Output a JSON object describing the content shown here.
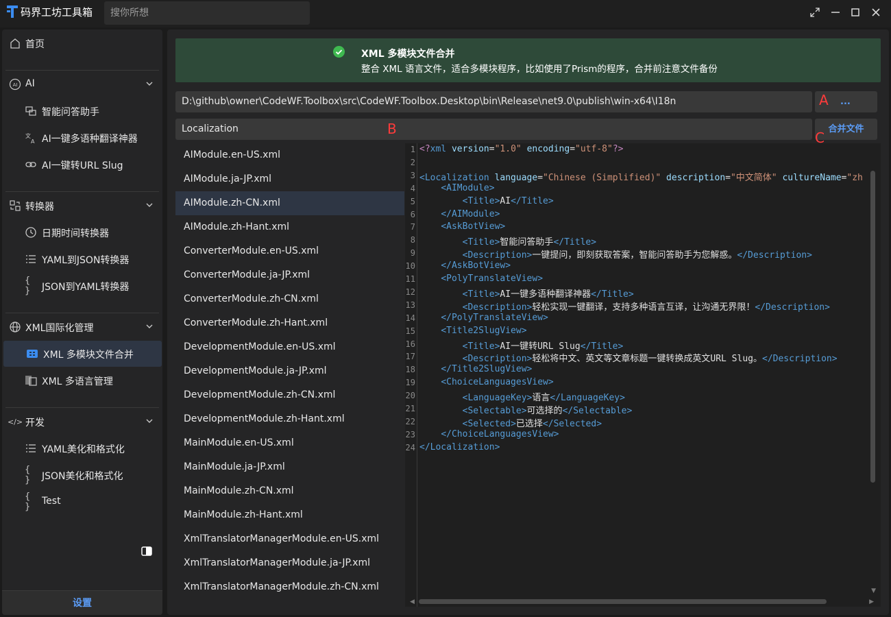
{
  "app": {
    "title": "码界工坊工具箱"
  },
  "search": {
    "placeholder": "搜你所想"
  },
  "sidebar": {
    "home": "首页",
    "groups": [
      {
        "label": "AI",
        "items": [
          "智能问答助手",
          "AI一键多语种翻译神器",
          "AI一键转URL Slug"
        ]
      },
      {
        "label": "转换器",
        "items": [
          "日期时间转换器",
          "YAML到JSON转换器",
          "JSON到YAML转换器"
        ]
      },
      {
        "label": "XML国际化管理",
        "items": [
          "XML 多模块文件合并",
          "XML 多语言管理"
        ]
      },
      {
        "label": "开发",
        "items": [
          "YAML美化和格式化",
          "JSON美化和格式化",
          "Test"
        ]
      }
    ],
    "settings": "设置"
  },
  "banner": {
    "title": "XML 多模块文件合并",
    "description": "整合 XML 语言文件，适合多模块程序，比如使用了Prism的程序，合并前注意文件备份"
  },
  "form": {
    "path_value": "D:\\github\\owner\\CodeWF.Toolbox\\src\\CodeWF.Toolbox.Desktop\\bin\\Release\\net9.0\\publish\\win-x64\\I18n",
    "browse_label": "...",
    "mark_a": "A",
    "name_value": "Localization",
    "mark_b": "B",
    "merge_label": "合并文件",
    "mark_c": "C"
  },
  "files": [
    "AIModule.en-US.xml",
    "AIModule.ja-JP.xml",
    "AIModule.zh-CN.xml",
    "AIModule.zh-Hant.xml",
    "ConverterModule.en-US.xml",
    "ConverterModule.ja-JP.xml",
    "ConverterModule.zh-CN.xml",
    "ConverterModule.zh-Hant.xml",
    "DevelopmentModule.en-US.xml",
    "DevelopmentModule.ja-JP.xml",
    "DevelopmentModule.zh-CN.xml",
    "DevelopmentModule.zh-Hant.xml",
    "MainModule.en-US.xml",
    "MainModule.ja-JP.xml",
    "MainModule.zh-CN.xml",
    "MainModule.zh-Hant.xml",
    "XmlTranslatorManagerModule.en-US.xml",
    "XmlTranslatorManagerModule.ja-JP.xml",
    "XmlTranslatorManagerModule.zh-CN.xml"
  ],
  "selected_file_index": 2,
  "editor": {
    "lines": [
      [
        [
          "pi",
          "<?"
        ],
        [
          "tag",
          "xml "
        ],
        [
          "attr",
          "version"
        ],
        [
          "txt",
          "="
        ],
        [
          "val",
          "\"1.0\""
        ],
        [
          "txt",
          " "
        ],
        [
          "attr",
          "encoding"
        ],
        [
          "txt",
          "="
        ],
        [
          "val",
          "\"utf-8\""
        ],
        [
          "pi",
          "?>"
        ]
      ],
      [],
      [
        [
          "tag",
          "<Localization "
        ],
        [
          "attr",
          "language"
        ],
        [
          "txt",
          "="
        ],
        [
          "val",
          "\"Chinese (Simplified)\""
        ],
        [
          "txt",
          " "
        ],
        [
          "attr",
          "description"
        ],
        [
          "txt",
          "="
        ],
        [
          "val",
          "\"中文简体\""
        ],
        [
          "txt",
          " "
        ],
        [
          "attr",
          "cultureName"
        ],
        [
          "txt",
          "="
        ],
        [
          "val",
          "\"zh"
        ]
      ],
      [
        [
          "txt",
          "    "
        ],
        [
          "tag",
          "<AIModule>"
        ]
      ],
      [
        [
          "txt",
          "        "
        ],
        [
          "tag",
          "<Title>"
        ],
        [
          "txt",
          "AI"
        ],
        [
          "tag",
          "</Title>"
        ]
      ],
      [
        [
          "txt",
          "    "
        ],
        [
          "tag",
          "</AIModule>"
        ]
      ],
      [
        [
          "txt",
          "    "
        ],
        [
          "tag",
          "<AskBotView>"
        ]
      ],
      [
        [
          "txt",
          "        "
        ],
        [
          "tag",
          "<Title>"
        ],
        [
          "txt",
          "智能问答助手"
        ],
        [
          "tag",
          "</Title>"
        ]
      ],
      [
        [
          "txt",
          "        "
        ],
        [
          "tag",
          "<Description>"
        ],
        [
          "txt",
          "一键提问，即刻获取答案，智能问答助手为您解惑。"
        ],
        [
          "tag",
          "</Description>"
        ]
      ],
      [
        [
          "txt",
          "    "
        ],
        [
          "tag",
          "</AskBotView>"
        ]
      ],
      [
        [
          "txt",
          "    "
        ],
        [
          "tag",
          "<PolyTranslateView>"
        ]
      ],
      [
        [
          "txt",
          "        "
        ],
        [
          "tag",
          "<Title>"
        ],
        [
          "txt",
          "AI一键多语种翻译神器"
        ],
        [
          "tag",
          "</Title>"
        ]
      ],
      [
        [
          "txt",
          "        "
        ],
        [
          "tag",
          "<Description>"
        ],
        [
          "txt",
          "轻松实现一键翻译，支持多种语言互译，让沟通无界限！"
        ],
        [
          "tag",
          "</Description>"
        ]
      ],
      [
        [
          "txt",
          "    "
        ],
        [
          "tag",
          "</PolyTranslateView>"
        ]
      ],
      [
        [
          "txt",
          "    "
        ],
        [
          "tag",
          "<Title2SlugView>"
        ]
      ],
      [
        [
          "txt",
          "        "
        ],
        [
          "tag",
          "<Title>"
        ],
        [
          "txt",
          "AI一键转URL Slug"
        ],
        [
          "tag",
          "</Title>"
        ]
      ],
      [
        [
          "txt",
          "        "
        ],
        [
          "tag",
          "<Description>"
        ],
        [
          "txt",
          "轻松将中文、英文等文章标题一键转换成英文URL Slug。"
        ],
        [
          "tag",
          "</Description>"
        ]
      ],
      [
        [
          "txt",
          "    "
        ],
        [
          "tag",
          "</Title2SlugView>"
        ]
      ],
      [
        [
          "txt",
          "    "
        ],
        [
          "tag",
          "<ChoiceLanguagesView>"
        ]
      ],
      [
        [
          "txt",
          "        "
        ],
        [
          "tag",
          "<LanguageKey>"
        ],
        [
          "txt",
          "语言"
        ],
        [
          "tag",
          "</LanguageKey>"
        ]
      ],
      [
        [
          "txt",
          "        "
        ],
        [
          "tag",
          "<Selectable>"
        ],
        [
          "txt",
          "可选择的"
        ],
        [
          "tag",
          "</Selectable>"
        ]
      ],
      [
        [
          "txt",
          "        "
        ],
        [
          "tag",
          "<Selected>"
        ],
        [
          "txt",
          "已选择"
        ],
        [
          "tag",
          "</Selected>"
        ]
      ],
      [
        [
          "txt",
          "    "
        ],
        [
          "tag",
          "</ChoiceLanguagesView>"
        ]
      ],
      [
        [
          "tag",
          "</Localization>"
        ]
      ]
    ]
  }
}
